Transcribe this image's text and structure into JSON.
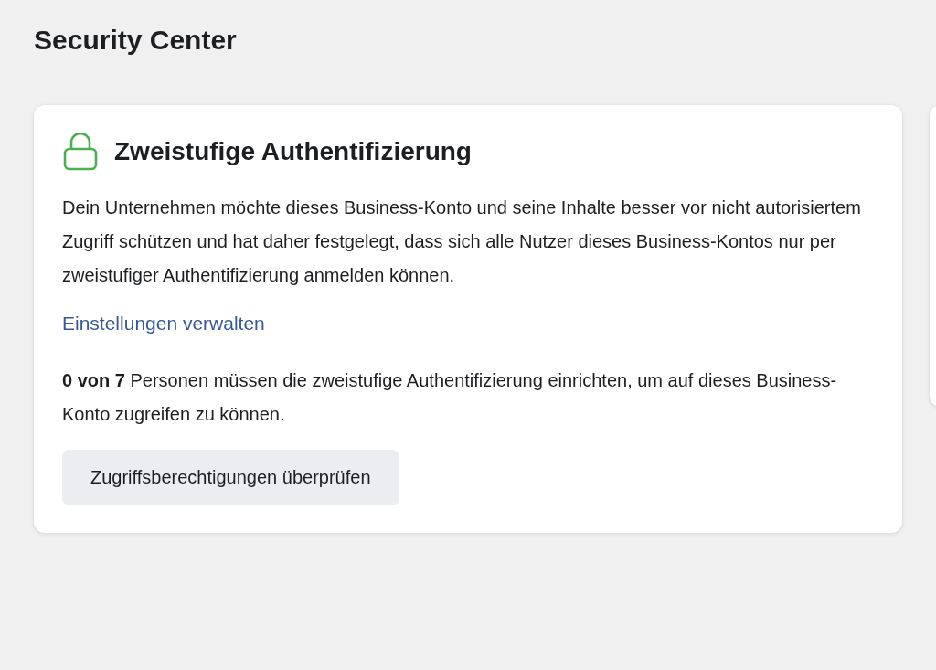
{
  "page": {
    "title": "Security Center"
  },
  "card": {
    "title": "Zweistufige Authentifizierung",
    "description": "Dein Unternehmen möchte dieses Business-Konto und seine Inhalte besser vor nicht autorisiertem Zugriff schützen und hat daher festgelegt, dass sich alle Nutzer dieses Business-Kontos nur per zweistufiger Authentifizierung anmelden können.",
    "link": "Einstellungen verwalten",
    "status": "**0 von 7** Personen müssen die zweistufige Authentifizierung einrichten, um auf dieses Business-Konto zugreifen zu können.",
    "button": "Zugriffsberechtigungen überprüfen"
  }
}
